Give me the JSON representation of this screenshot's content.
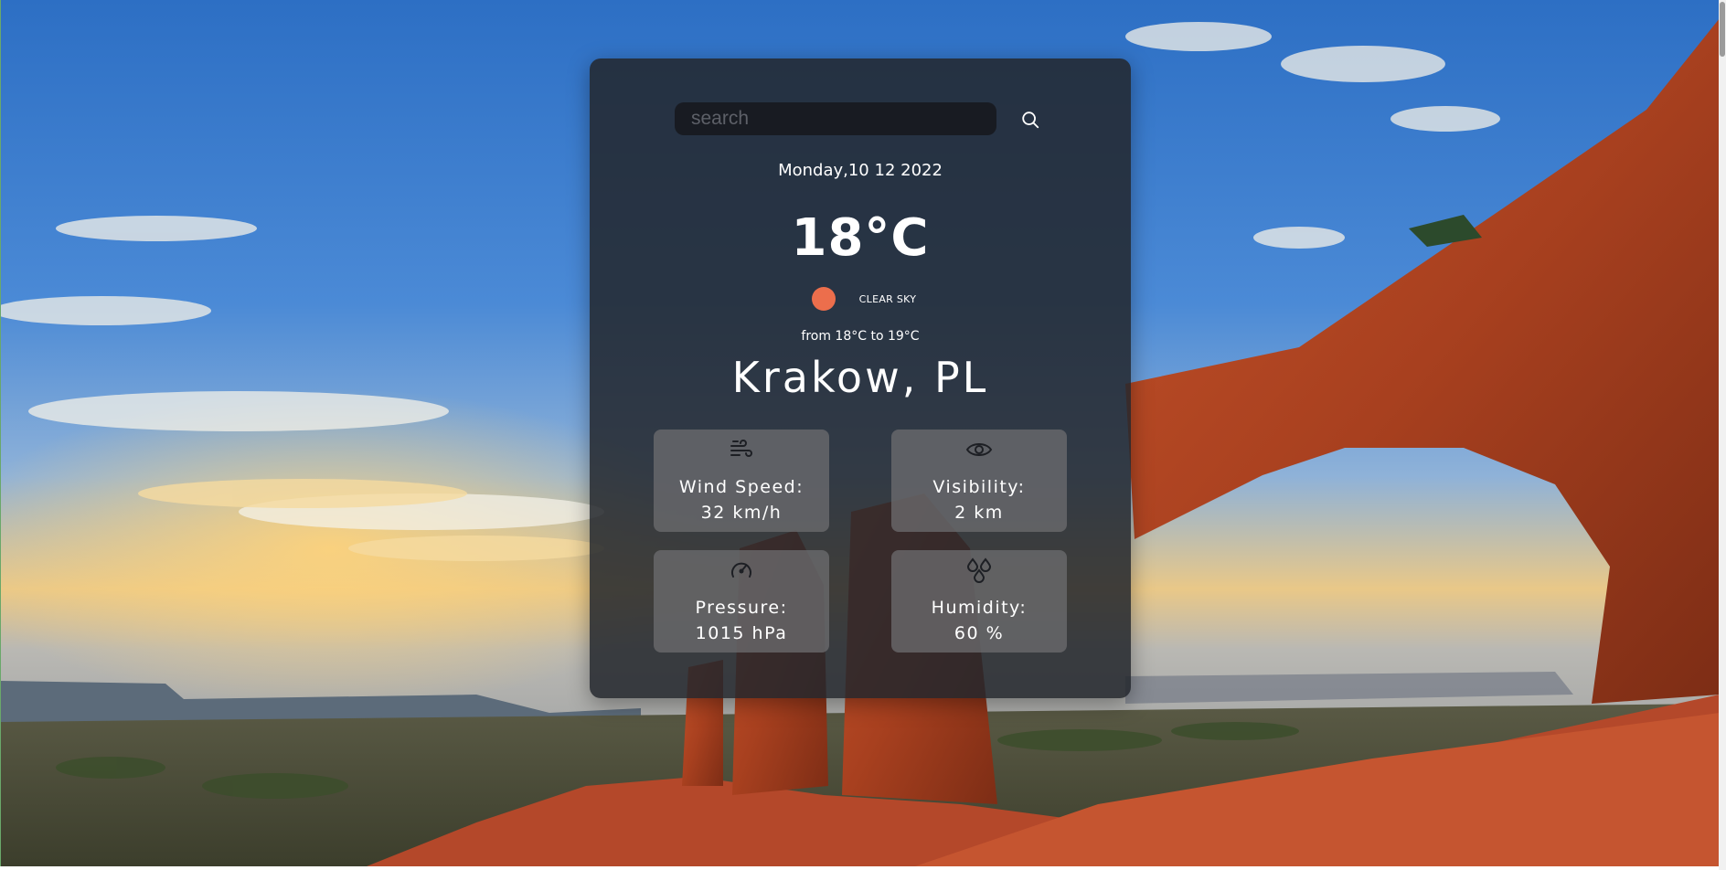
{
  "search": {
    "placeholder": "search",
    "value": "",
    "button_icon": "search-icon"
  },
  "weather": {
    "date": "Monday,10 12 2022",
    "temperature": "18°C",
    "condition": "CLEAR SKY",
    "condition_icon_color": "#ec6e4c",
    "range": "from 18°C to 19°C",
    "location": "Krakow, PL"
  },
  "details": [
    {
      "icon": "wind-icon",
      "label": "Wind Speed:",
      "value": "32 km/h"
    },
    {
      "icon": "eye-icon",
      "label": "Visibility:",
      "value": "2 km"
    },
    {
      "icon": "gauge-icon",
      "label": "Pressure:",
      "value": "1015 hPa"
    },
    {
      "icon": "droplets-icon",
      "label": "Humidity:",
      "value": "60 %"
    }
  ]
}
